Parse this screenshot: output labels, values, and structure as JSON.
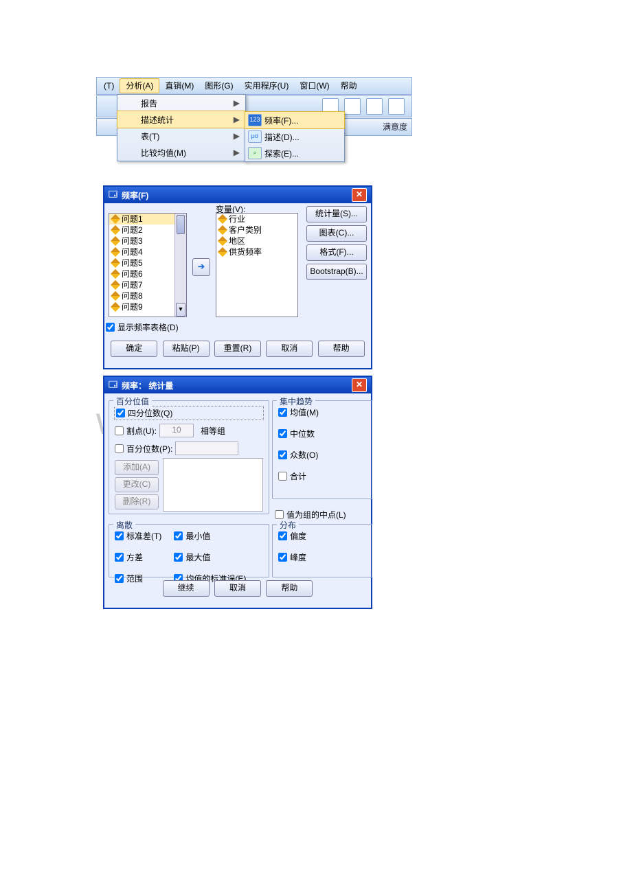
{
  "watermark": "www.b    cx.com",
  "menu": {
    "items": [
      "(T)",
      "分析(A)",
      "直销(M)",
      "图形(G)",
      "实用程序(U)",
      "窗口(W)",
      "帮助"
    ],
    "flyout": [
      {
        "label": "报告",
        "arrow": true,
        "sel": false
      },
      {
        "label": "描述统计",
        "arrow": true,
        "sel": true
      },
      {
        "label": "表(T)",
        "arrow": true,
        "sel": false
      },
      {
        "label": "比较均值(M)",
        "arrow": true,
        "sel": false
      }
    ],
    "submenu": [
      {
        "label": "频率(F)...",
        "sel": true,
        "ic": "f"
      },
      {
        "label": "描述(D)...",
        "sel": false,
        "ic": "d"
      },
      {
        "label": "探索(E)...",
        "sel": false,
        "ic": "e"
      }
    ],
    "grid_label": "满意度"
  },
  "freq": {
    "title": "频率(F)",
    "left": [
      "问题1",
      "问题2",
      "问题3",
      "问题4",
      "问题5",
      "问题6",
      "问题7",
      "问题8",
      "问题9"
    ],
    "var_label": "变量(V):",
    "right": [
      "行业",
      "客户类别",
      "地区",
      "供货频率"
    ],
    "side": [
      "统计量(S)...",
      "图表(C)...",
      "格式(F)...",
      "Bootstrap(B)..."
    ],
    "show_table": "显示频率表格(D)",
    "buttons": [
      "确定",
      "粘贴(P)",
      "重置(R)",
      "取消",
      "帮助"
    ]
  },
  "stats": {
    "title": "频率： 统计量",
    "pct": {
      "legend": "百分位值",
      "quart": "四分位数(Q)",
      "cut": "割点(U):",
      "cut_val": "10",
      "cut_tail": "相等组",
      "pct": "百分位数(P):",
      "add": "添加(A)",
      "chg": "更改(C)",
      "del": "删除(R)"
    },
    "ct": {
      "legend": "集中趋势",
      "mean": "均值(M)",
      "median": "中位数",
      "mode": "众数(O)",
      "sum": "合计"
    },
    "mid": "值为组的中点(L)",
    "disp": {
      "legend": "离散",
      "std": "标准差(T)",
      "min": "最小值",
      "var": "方差",
      "max": "最大值",
      "range": "范围",
      "se": "均值的标准误(E)"
    },
    "dist": {
      "legend": "分布",
      "skew": "偏度",
      "kurt": "峰度"
    },
    "buttons": [
      "继续",
      "取消",
      "帮助"
    ]
  }
}
